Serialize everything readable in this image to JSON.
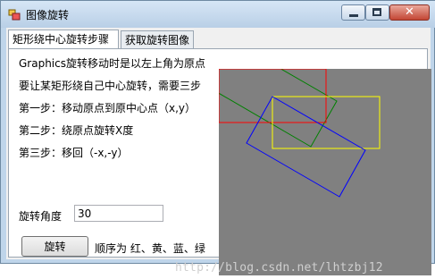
{
  "window": {
    "title": "图像旋转"
  },
  "tabs": [
    {
      "label": "矩形绕中心旋转步骤"
    },
    {
      "label": "获取旋转图像"
    }
  ],
  "content": {
    "line1": "Graphics旋转移动时是以左上角为原点",
    "line2": "要让某矩形绕自己中心旋转，需要三步",
    "step1": "第一步：移动原点到原中心点（x,y）",
    "step2": "第二步：绕原点旋转X度",
    "step3": "第三步：移回（-x,-y）",
    "angle_label": "旋转角度",
    "angle_value": "30",
    "rotate_button": "旋转",
    "order_text": "顺序为 红、黄、蓝、绿"
  },
  "watermark": "http://blog.csdn.net/lhtzbj12",
  "colors": {
    "canvas_bg": "#808080",
    "red": "#ff0000",
    "yellow": "#ffff00",
    "blue": "#0000ff",
    "green": "#008000"
  }
}
